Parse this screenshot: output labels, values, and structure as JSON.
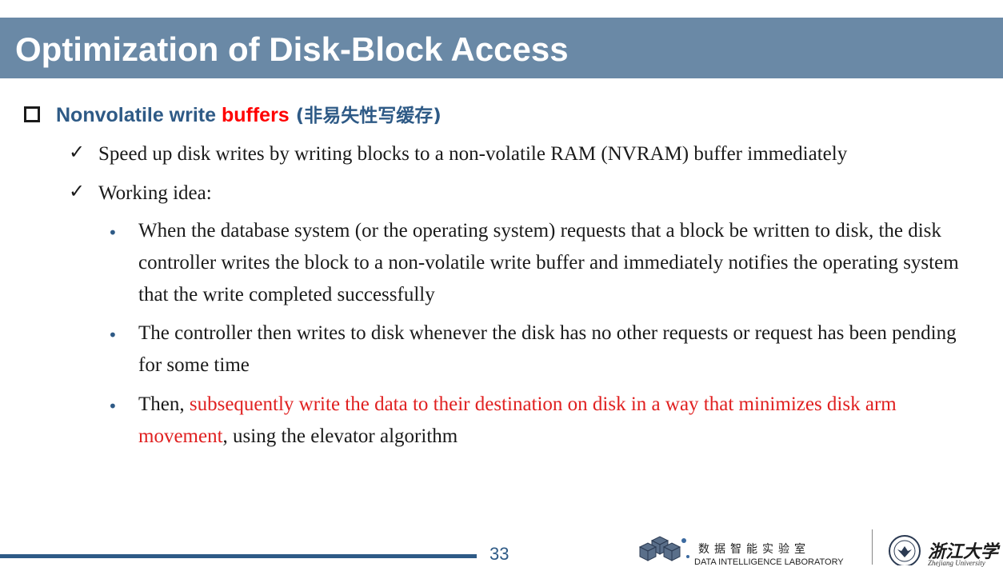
{
  "slide": {
    "title": "Optimization of Disk-Block Access",
    "heading": {
      "prefix": "Nonvolatile write ",
      "highlight": "buffers",
      "suffix_cn": " (非易失性写缓存)"
    },
    "checks": [
      "Speed up disk writes by writing blocks to a non-volatile RAM (NVRAM) buffer immediately",
      "Working idea:"
    ],
    "bullets": {
      "b1": "When the database system (or the operating system) requests that a block be written to disk, the disk controller writes the block to a non-volatile write buffer and immediately notifies the operating system that the write completed successfully",
      "b2": "The controller then writes to disk whenever the disk has no other requests or request has been pending for some time",
      "b3_prefix": "Then, ",
      "b3_highlight": "subsequently write the data to their destination on disk in a way that minimizes disk arm movement",
      "b3_suffix": ", using the elevator algorithm"
    },
    "page_number": "33"
  },
  "footer": {
    "lab_name_cn": "数据智能实验室",
    "lab_name_en": "DATA INTELLIGENCE LABORATORY",
    "university_cn": "浙江大学",
    "university_en": "Zhejiang University"
  },
  "colors": {
    "title_bar": "#6a89a6",
    "heading": "#2e5a86",
    "highlight": "#ff0000",
    "footer_line": "#2e5a86"
  }
}
